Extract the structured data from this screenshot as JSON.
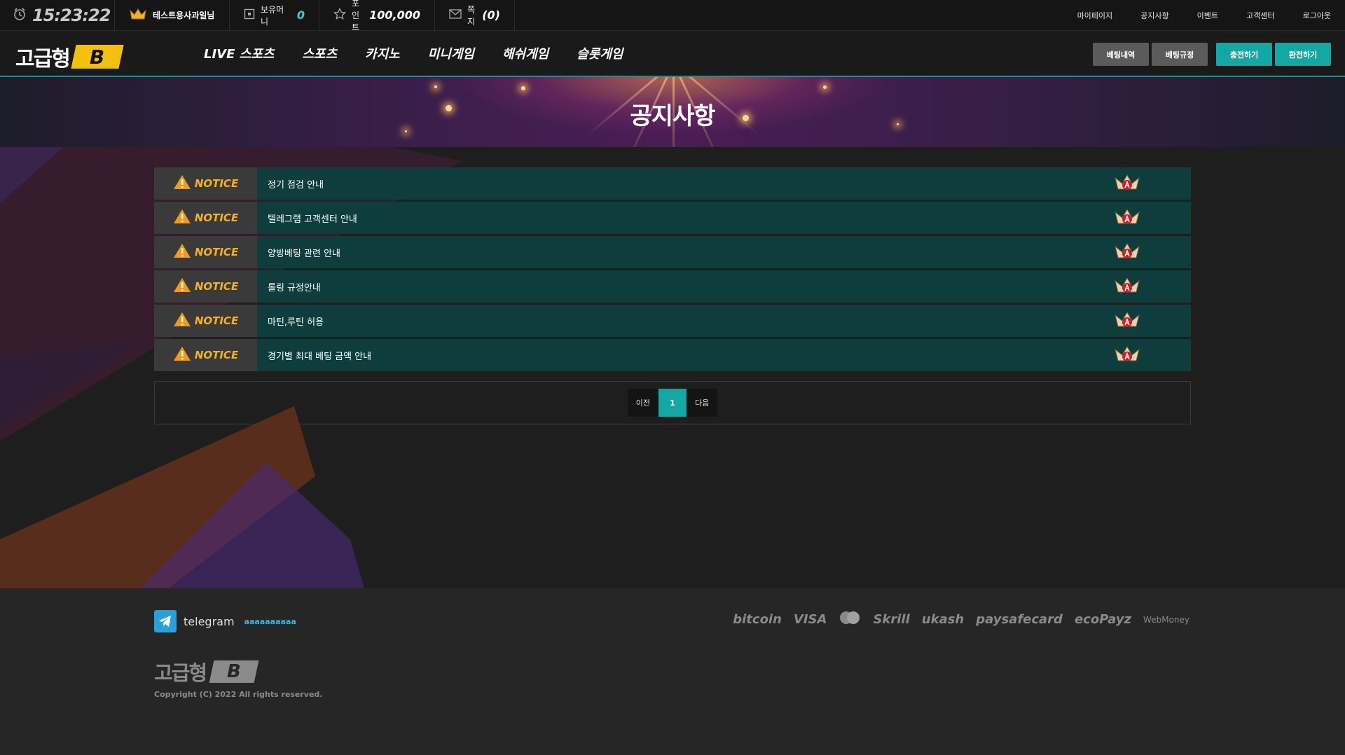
{
  "topbar": {
    "time": "15:23:22",
    "username": "테스트용사과일님",
    "money_label": "보유머니",
    "money_value": "0",
    "point_label": "포인트",
    "point_value": "100,000",
    "message_label": "쪽지",
    "message_count": "(0)",
    "links": [
      "마이페이지",
      "공지사항",
      "이벤트",
      "고객센터",
      "로그아웃"
    ]
  },
  "nav": {
    "logo_word": "고급형",
    "logo_badge": "B",
    "menu": [
      "LIVE 스포츠",
      "스포츠",
      "카지노",
      "미니게임",
      "해쉬게임",
      "슬롯게임"
    ],
    "buttons": [
      "베팅내역",
      "베팅규정",
      "충전하기",
      "환전하기"
    ]
  },
  "banner": {
    "title": "공지사항"
  },
  "notices": {
    "tag": "NOTICE",
    "items": [
      "정기 점검 안내",
      "텔레그램 고객센터 안내",
      "양방베팅 관련 안내",
      "롤링 규정안내",
      "마틴,루틴 허용",
      "경기별 최대 베팅 금액 안내"
    ]
  },
  "pager": {
    "prev": "이전",
    "current": "1",
    "next": "다음"
  },
  "footer": {
    "telegram_label": "telegram",
    "telegram_id": "aaaaaaaaaa",
    "payments": [
      "bitcoin",
      "VISA",
      "Skrill",
      "ukash",
      "paysafecard",
      "ecoPayz",
      "WebMoney"
    ],
    "logo_word": "고급형",
    "logo_badge": "B",
    "copyright": "Copyright (C) 2022 All rights reserved."
  },
  "colors": {
    "accent_teal": "#14a7a4",
    "notice_row": "#0f3c3d",
    "notice_tag": "#f6b11f",
    "logo_yellow": "#f4c010"
  }
}
